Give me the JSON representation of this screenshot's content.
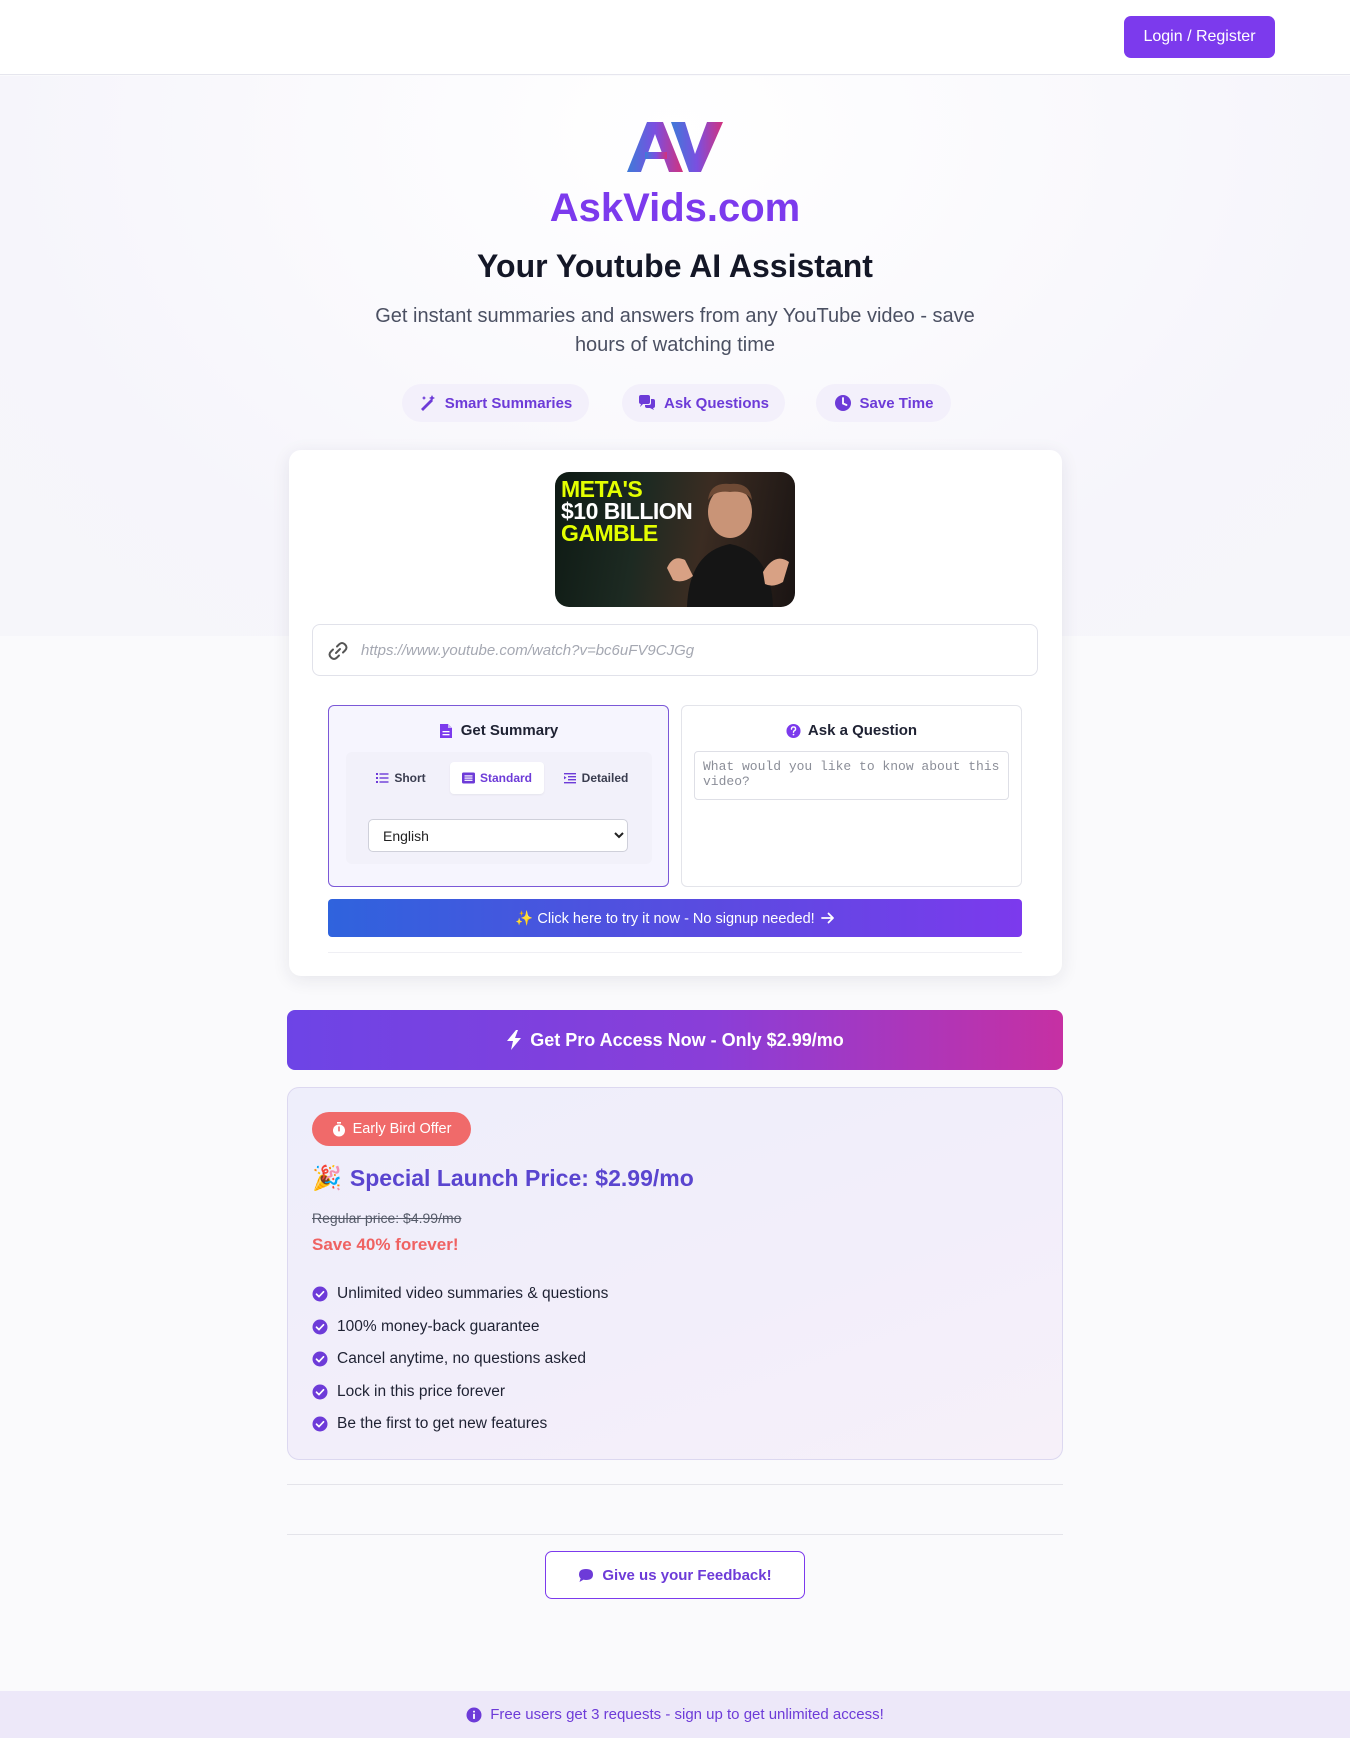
{
  "header": {
    "login_label": "Login / Register"
  },
  "hero": {
    "logo_text": "AV",
    "brand": "AskVids.com",
    "headline": "Your Youtube AI Assistant",
    "subheadline": "Get instant summaries and answers from any YouTube video - save hours of watching time",
    "features": [
      {
        "icon": "magic-wand-icon",
        "label": "Smart Summaries"
      },
      {
        "icon": "chat-bubbles-icon",
        "label": "Ask Questions"
      },
      {
        "icon": "clock-icon",
        "label": "Save Time"
      }
    ]
  },
  "video": {
    "thumbnail_lines": [
      "META'S",
      "$10 BILLION",
      "GAMBLE"
    ],
    "url_placeholder": "https://www.youtube.com/watch?v=bc6uFV9CJGg"
  },
  "summary_panel": {
    "title": "Get Summary",
    "lengths": [
      {
        "icon": "list-icon",
        "label": "Short"
      },
      {
        "icon": "card-list-icon",
        "label": "Standard",
        "active": true
      },
      {
        "icon": "indent-list-icon",
        "label": "Detailed"
      }
    ],
    "language_options": [
      "English"
    ],
    "language_selected": "English"
  },
  "question_panel": {
    "title": "Ask a Question",
    "placeholder": "What would you like to know about this video?"
  },
  "try_button_label": "✨ Click here to try it now - No signup needed!",
  "pro_button_label": "Get Pro Access Now - Only $2.99/mo",
  "offer": {
    "badge": "Early Bird Offer",
    "title_emoji": "🎉",
    "title": "Special Launch Price: $2.99/mo",
    "regular_price": "Regular price: $4.99/mo",
    "savings": "Save 40% forever!",
    "features": [
      "Unlimited video summaries & questions",
      "100% money-back guarantee",
      "Cancel anytime, no questions asked",
      "Lock in this price forever",
      "Be the first to get new features"
    ]
  },
  "feedback_label": "Give us your Feedback!",
  "footer_notice": "Free users get 3 requests - sign up to get unlimited access!",
  "colors": {
    "accent": "#7c3aed",
    "danger": "#f06a6a",
    "gradient_start": "#2f63dd",
    "gradient_end": "#c630a3"
  }
}
